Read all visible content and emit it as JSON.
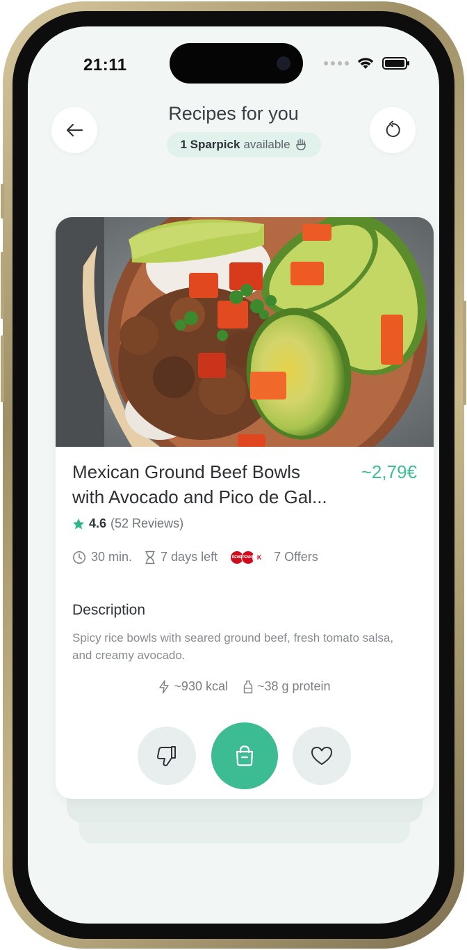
{
  "status_bar": {
    "time": "21:11"
  },
  "header": {
    "title": "Recipes for you",
    "sparpick": {
      "count_label": "1 Sparpick",
      "suffix": "available"
    }
  },
  "recipe": {
    "title_line1": "Mexican Ground Beef Bowls",
    "title_line2": "with Avocado and Pico de Gal...",
    "price": "~2,79€",
    "rating": "4.6",
    "reviews": "(52 Reviews)",
    "time": "30 min.",
    "days_left": "7 days left",
    "offers": "7 Offers",
    "store_logos": [
      {
        "name": "REWE",
        "color": "#cc0f1f"
      },
      {
        "name": "PENNY",
        "color": "#d20a1e"
      },
      {
        "name": "Kaufland",
        "color": "#e1001a"
      }
    ],
    "description_label": "Description",
    "description": "Spicy rice bowls with seared ground beef, fresh tomato salsa, and creamy avocado.",
    "kcal": "~930 kcal",
    "protein": "~38 g protein"
  },
  "colors": {
    "accent": "#3dbb92",
    "price": "#3bbf93",
    "star": "#2fb58a",
    "screen_bg": "#f2f6f5"
  },
  "icons": [
    "back-arrow-icon",
    "refresh-icon",
    "sparpick-hand-icon",
    "star-icon",
    "clock-icon",
    "hourglass-icon",
    "lightning-icon",
    "bottle-icon",
    "thumbs-down-icon",
    "shopping-bag-icon",
    "heart-icon"
  ]
}
